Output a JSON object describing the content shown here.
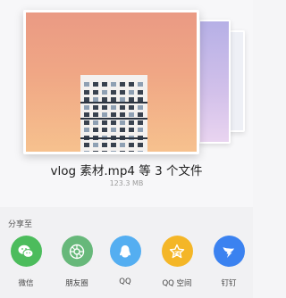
{
  "preview": {
    "title": "vlog 素材.mp4 等 3 个文件",
    "size": "123.3 MB"
  },
  "share": {
    "title": "分享至",
    "apps": [
      {
        "label": "微信",
        "icon": "wechat-icon",
        "color": "#4cbc5c"
      },
      {
        "label": "朋友圈",
        "icon": "moments-icon",
        "color": "#67b87a"
      },
      {
        "label": "QQ",
        "icon": "qq-icon",
        "color": "#54aef1"
      },
      {
        "label": "QQ 空间",
        "icon": "qzone-icon",
        "color": "#f4b627"
      },
      {
        "label": "钉钉",
        "icon": "dingtalk-icon",
        "color": "#3b82f0"
      }
    ]
  }
}
